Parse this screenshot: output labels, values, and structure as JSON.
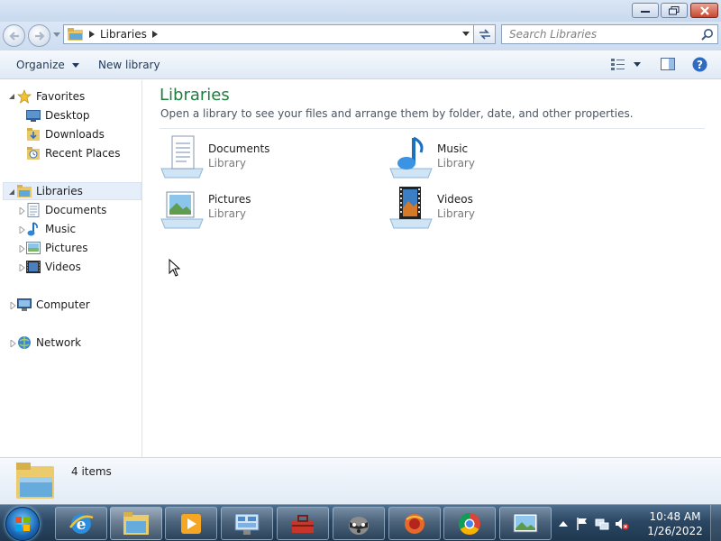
{
  "window": {
    "address": {
      "crumb": "Libraries"
    },
    "search": {
      "placeholder": "Search Libraries"
    }
  },
  "toolbar": {
    "organize_label": "Organize",
    "new_library_label": "New library"
  },
  "nav": {
    "favorites": "Favorites",
    "desktop": "Desktop",
    "downloads": "Downloads",
    "recent_places": "Recent Places",
    "libraries": "Libraries",
    "documents": "Documents",
    "music": "Music",
    "pictures": "Pictures",
    "videos": "Videos",
    "computer": "Computer",
    "network": "Network"
  },
  "content": {
    "title": "Libraries",
    "subtitle": "Open a library to see your files and arrange them by folder, date, and other properties.",
    "tiles": [
      {
        "name": "Documents",
        "kind": "Library",
        "icon": "documents-library-icon"
      },
      {
        "name": "Music",
        "kind": "Library",
        "icon": "music-library-icon"
      },
      {
        "name": "Pictures",
        "kind": "Library",
        "icon": "pictures-library-icon"
      },
      {
        "name": "Videos",
        "kind": "Library",
        "icon": "videos-library-icon"
      }
    ]
  },
  "details": {
    "count": "4 items"
  },
  "taskbar": {
    "apps": [
      "internet-explorer",
      "windows-explorer",
      "media-player",
      "control-panel",
      "toolbox",
      "raccoon-app",
      "firefox-like",
      "chrome",
      "photo-viewer"
    ],
    "time": "10:48 AM",
    "date": "1/26/2022"
  },
  "colors": {
    "title_green": "#1e7e3e",
    "taskbar": "#2b4763"
  }
}
